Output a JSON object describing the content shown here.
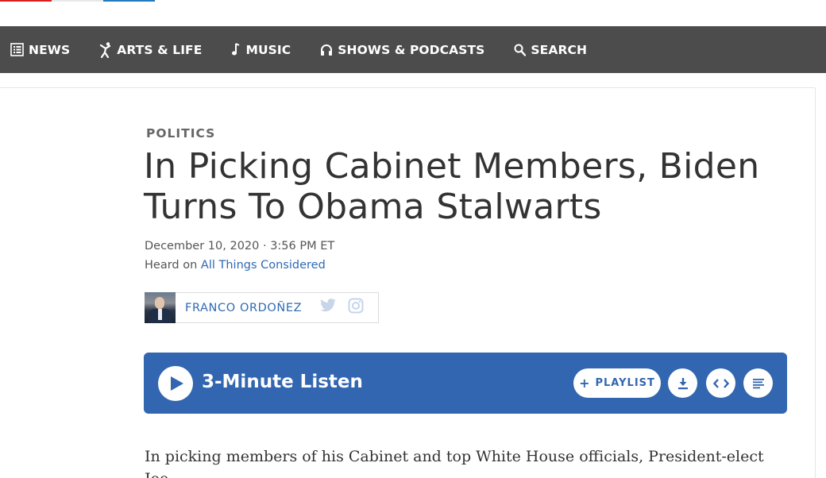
{
  "brand": {
    "logo_colors": [
      "#d62021",
      "#e8e8e8",
      "#237bbd"
    ]
  },
  "nav": {
    "items": [
      {
        "label": "NEWS",
        "icon": "news-list-icon"
      },
      {
        "label": "ARTS & LIFE",
        "icon": "dancer-icon"
      },
      {
        "label": "MUSIC",
        "icon": "music-note-icon"
      },
      {
        "label": "SHOWS & PODCASTS",
        "icon": "headphones-icon"
      },
      {
        "label": "SEARCH",
        "icon": "search-icon"
      }
    ],
    "background": "#4c4c4c"
  },
  "article": {
    "slug": "POLITICS",
    "headline": "In Picking Cabinet Members, Biden Turns To Obama Stalwarts",
    "dateline": "December 10, 2020 · 3:56 PM ET",
    "heard_prefix": "Heard on ",
    "show_name": "All Things Considered",
    "author": "FRANCO ORDOÑEZ",
    "social_icons": [
      "twitter-icon",
      "instagram-icon"
    ],
    "body_first_line": "In picking members of his Cabinet and top White House officials, President-elect Joe"
  },
  "player": {
    "title": "3-Minute Listen",
    "playlist_label": "PLAYLIST",
    "accent": "#3266b0",
    "actions": [
      "download-icon",
      "embed-code-icon",
      "transcript-icon"
    ]
  }
}
